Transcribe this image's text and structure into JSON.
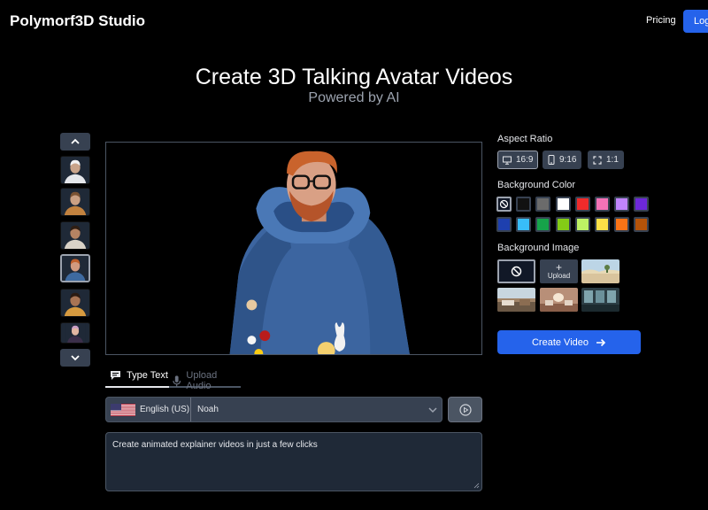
{
  "header": {
    "brand": "Polymorf3D Studio",
    "pricing_label": "Pricing",
    "login_label": "Login"
  },
  "hero": {
    "title": "Create 3D Talking Avatar Videos",
    "subtitle": "Powered by AI"
  },
  "avatars": {
    "items": [
      {
        "name": "avatar-1",
        "skin": "#c9a48a",
        "hair": "#f2f2f2",
        "top": "#e5e7eb"
      },
      {
        "name": "avatar-2",
        "skin": "#caa083",
        "hair": "#7a5233",
        "top": "#c2823f"
      },
      {
        "name": "avatar-3",
        "skin": "#b58363",
        "hair": "#2e1e14",
        "top": "#d9d2c7"
      },
      {
        "name": "avatar-4",
        "skin": "#d19a7f",
        "hair": "#c0602c",
        "top": "#3e6aa0"
      },
      {
        "name": "avatar-5",
        "skin": "#a87454",
        "hair": "#2b1b12",
        "top": "#d69a3f"
      },
      {
        "name": "avatar-6",
        "skin": "#e2b7a2",
        "hair": "#c99ec6",
        "top": "#3b2f4a"
      }
    ],
    "selected_index": 3
  },
  "tabs": {
    "type_text": "Type Text",
    "upload_audio": "Upload Audio",
    "active": "type_text"
  },
  "voice": {
    "language": "English (US)",
    "voice_name": "Noah"
  },
  "script": {
    "text": "Create animated explainer videos in just a few clicks"
  },
  "aspect_ratio": {
    "label": "Aspect Ratio",
    "options": [
      "16:9",
      "9:16",
      "1:1"
    ],
    "selected": "16:9"
  },
  "background_color": {
    "label": "Background Color",
    "colors": [
      "none",
      "#111111",
      "#6b6b6b",
      "#ffffff",
      "#ef2b2b",
      "#f472b6",
      "#c084fc",
      "#6d28d9",
      "#1e40af",
      "#38bdf8",
      "#16a34a",
      "#84cc16",
      "#bef264",
      "#fde047",
      "#f97316",
      "#b45309"
    ],
    "selected": "none"
  },
  "background_image": {
    "label": "Background Image",
    "upload_label": "Upload"
  },
  "create_button": {
    "label": "Create Video"
  }
}
